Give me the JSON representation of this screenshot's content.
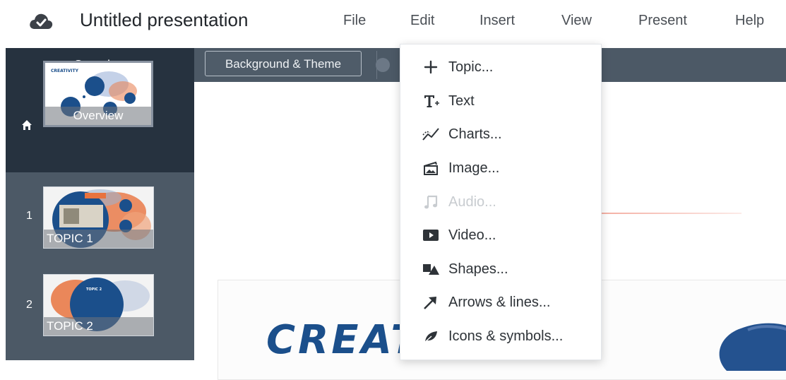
{
  "app": {
    "title": "Untitled presentation",
    "accent": "#1b4f8b",
    "sidebar_color": "#4c5966",
    "sidebar_dark": "#26323f"
  },
  "menu": {
    "file": "File",
    "edit": "Edit",
    "insert": "Insert",
    "view": "View",
    "present": "Present",
    "help": "Help"
  },
  "sidebar": {
    "header": "Overview",
    "slides": [
      {
        "number": "",
        "caption": "Overview",
        "thumb_text": "CREATIVITY"
      },
      {
        "number": "1",
        "caption": "TOPIC 1",
        "thumb_text": "TOPIC 1"
      },
      {
        "number": "2",
        "caption": "TOPIC 2",
        "thumb_text": "TOPIC 2"
      }
    ]
  },
  "toolbar": {
    "background_theme": "Background & Theme"
  },
  "canvas": {
    "slide_title": "CREAT"
  },
  "insert_menu": {
    "items": [
      {
        "label": "Topic...",
        "icon": "plus-icon",
        "enabled": true
      },
      {
        "label": "Text",
        "icon": "text-icon",
        "enabled": true
      },
      {
        "label": "Charts...",
        "icon": "chart-icon",
        "enabled": true
      },
      {
        "label": "Image...",
        "icon": "image-icon",
        "enabled": true
      },
      {
        "label": "Audio...",
        "icon": "music-note-icon",
        "enabled": false
      },
      {
        "label": "Video...",
        "icon": "video-icon",
        "enabled": true
      },
      {
        "label": "Shapes...",
        "icon": "shapes-icon",
        "enabled": true
      },
      {
        "label": "Arrows & lines...",
        "icon": "arrow-icon",
        "enabled": true
      },
      {
        "label": "Icons & symbols...",
        "icon": "leaf-icon",
        "enabled": true
      }
    ]
  }
}
